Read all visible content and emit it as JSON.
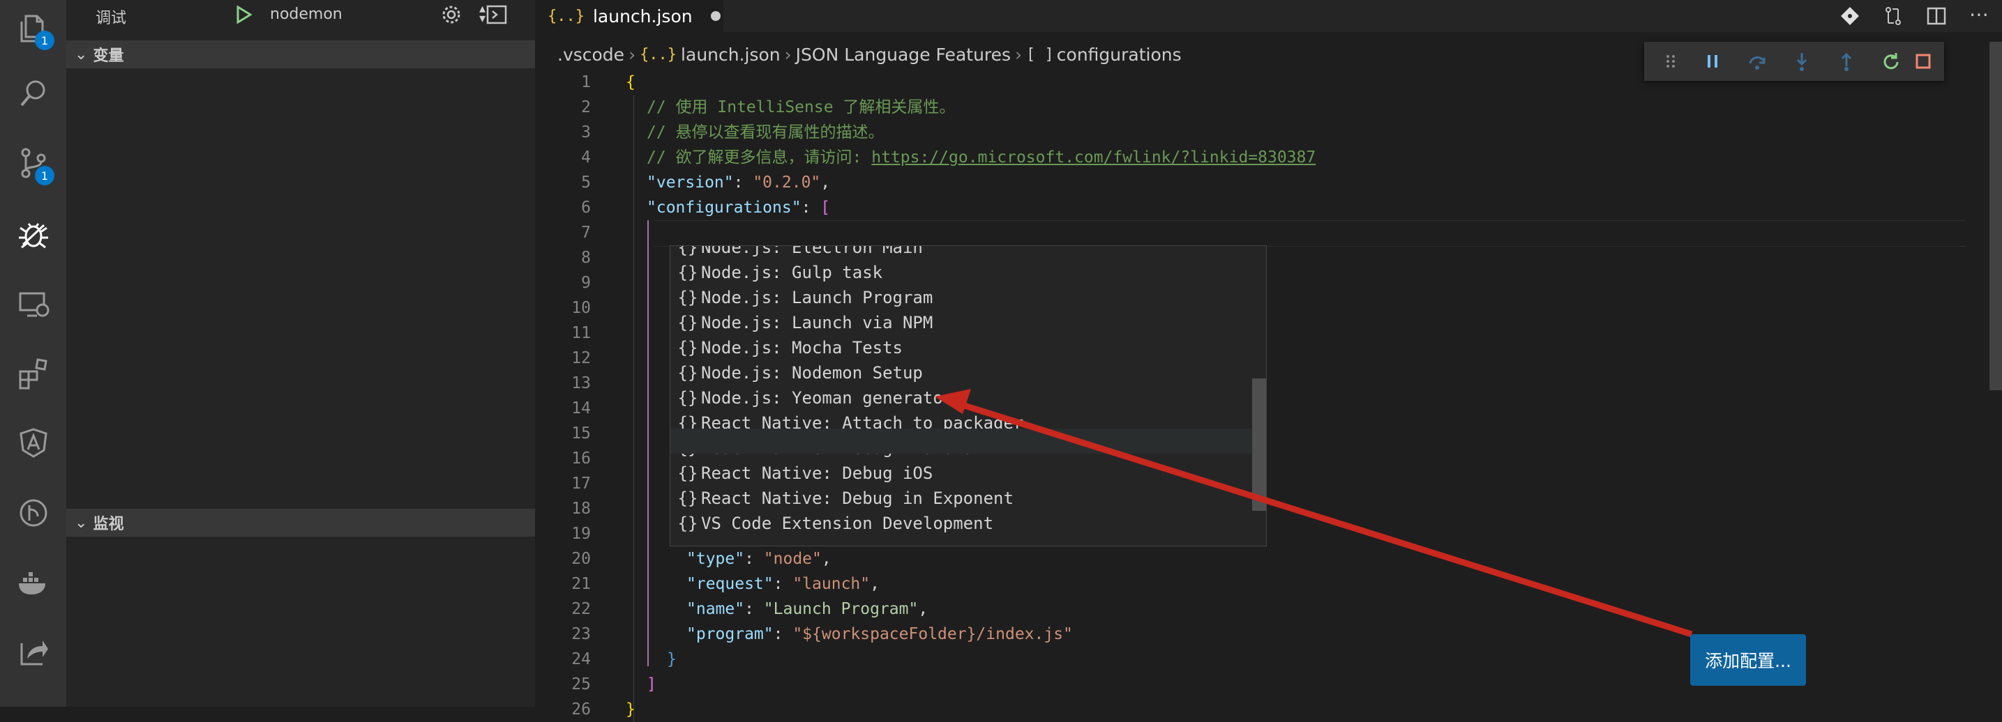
{
  "activity_bar": {
    "explorer_badge": "1",
    "scm_badge": "1"
  },
  "sidebar": {
    "debug_label": "调试",
    "config_select": "nodemon",
    "variables_header": "变量",
    "watch_header": "监视"
  },
  "tab": {
    "icon": "{..}",
    "title": "launch.json"
  },
  "breadcrumb": {
    "items": [
      ".vscode",
      "launch.json",
      "JSON Language Features",
      "configurations"
    ],
    "json_icon": "{..}",
    "array_icon": "[ ]"
  },
  "code_lines": [
    {
      "n": "1"
    },
    {
      "n": "2"
    },
    {
      "n": "3"
    },
    {
      "n": "4"
    },
    {
      "n": "5"
    },
    {
      "n": "6"
    },
    {
      "n": "7"
    },
    {
      "n": "8"
    },
    {
      "n": "9"
    },
    {
      "n": "10"
    },
    {
      "n": "11"
    },
    {
      "n": "12"
    },
    {
      "n": "13"
    },
    {
      "n": "14"
    },
    {
      "n": "15"
    },
    {
      "n": "16"
    },
    {
      "n": "17"
    },
    {
      "n": "18"
    },
    {
      "n": "19"
    },
    {
      "n": "20"
    },
    {
      "n": "21"
    },
    {
      "n": "22"
    },
    {
      "n": "23"
    },
    {
      "n": "24"
    },
    {
      "n": "25"
    },
    {
      "n": "26"
    }
  ],
  "code": {
    "l1": "{",
    "l2": "// 使用 IntelliSense 了解相关属性。",
    "l3": "// 悬停以查看现有属性的描述。",
    "l4_prefix": "// 欲了解更多信息，请访问: ",
    "l4_link": "https://go.microsoft.com/fwlink/?linkid=830387",
    "l5_key": "\"version\"",
    "l5_val": "\"0.2.0\"",
    "l6_key": "\"configurations\"",
    "l6_open": "[",
    "l20_key": "\"type\"",
    "l20_val": "\"node\"",
    "l21_key": "\"request\"",
    "l21_val": "\"launch\"",
    "l22_key": "\"name\"",
    "l22_val": "\"Launch Program\"",
    "l23_key": "\"program\"",
    "l23_val": "\"${workspaceFolder}/index.js\"",
    "l24": "}",
    "l25": "]",
    "l26": "}"
  },
  "suggest": {
    "icon": "{}",
    "items": [
      "Node.js: Electron Main",
      "Node.js: Gulp task",
      "Node.js: Launch Program",
      "Node.js: Launch via NPM",
      "Node.js: Mocha Tests",
      "Node.js: Nodemon Setup",
      "Node.js: Yeoman generator",
      "React Native: Attach to packager",
      "React Native: Debug Android",
      "React Native: Debug iOS",
      "React Native: Debug in Exponent",
      "VS Code Extension Development"
    ]
  },
  "add_config_button": "添加配置...",
  "colors": {
    "accent": "#007acc",
    "button": "#0e639c",
    "arrow": "#c8281e"
  }
}
